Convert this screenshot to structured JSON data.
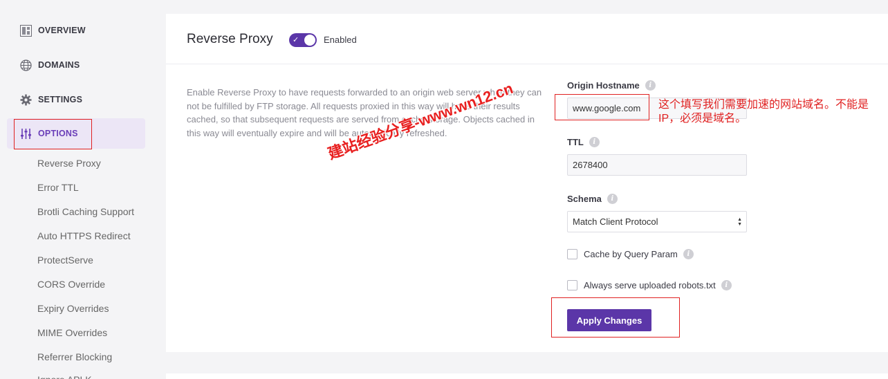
{
  "sidebar": {
    "nav": [
      {
        "label": "OVERVIEW",
        "icon": "overview-icon"
      },
      {
        "label": "DOMAINS",
        "icon": "globe-icon"
      },
      {
        "label": "SETTINGS",
        "icon": "gear-icon"
      },
      {
        "label": "OPTIONS",
        "icon": "sliders-icon",
        "active": true
      }
    ],
    "sub_items": [
      "Reverse Proxy",
      "Error TTL",
      "Brotli Caching Support",
      "Auto HTTPS Redirect",
      "ProtectServe",
      "CORS Override",
      "Expiry Overrides",
      "MIME Overrides",
      "Referrer Blocking",
      "Ignore APLK"
    ]
  },
  "panel": {
    "title": "Reverse Proxy",
    "toggle_label": "Enabled",
    "toggle_on": true,
    "description": "Enable Reverse Proxy to have requests forwarded to an origin web server when they can not be fulfilled by FTP storage. All requests proxied in this way will have their results cached, so that subsequent requests are served from cache storage. Objects cached in this way will eventually expire and will be automatically refreshed.",
    "origin_hostname": {
      "label": "Origin Hostname",
      "value": "www.google.com"
    },
    "ttl": {
      "label": "TTL",
      "value": "2678400"
    },
    "schema": {
      "label": "Schema",
      "value": "Match Client Protocol"
    },
    "cache_by_query": {
      "label": "Cache by Query Param",
      "checked": false
    },
    "robots": {
      "label": "Always serve uploaded robots.txt",
      "checked": false
    },
    "apply_label": "Apply Changes"
  },
  "annotations": {
    "note": "这个填写我们需要加速的网站域名。不能是IP，必须是域名。",
    "watermark": "建站经验分享-www.wn12.cn"
  },
  "colors": {
    "accent": "#5b36a8",
    "annotation": "#e02020"
  }
}
